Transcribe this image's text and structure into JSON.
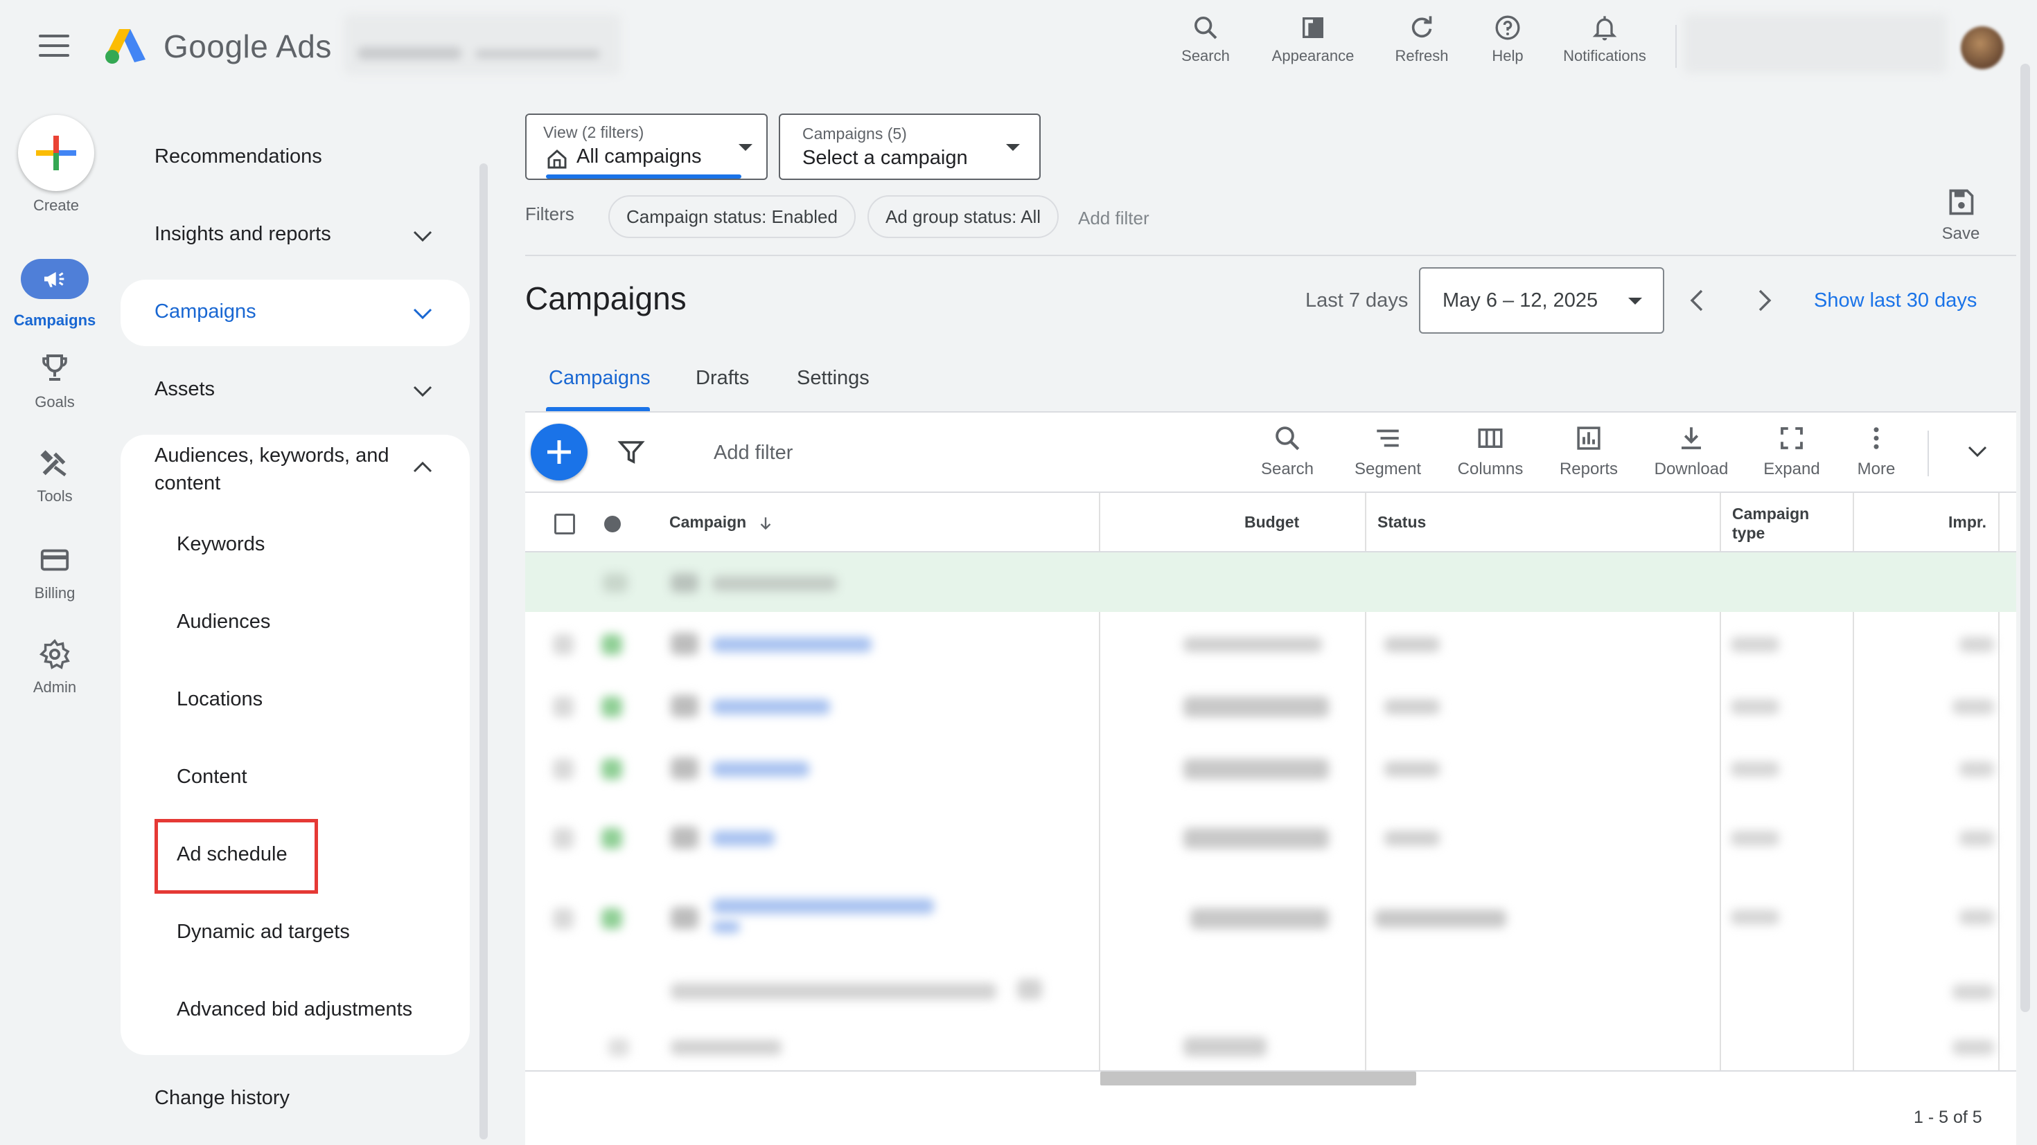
{
  "app": {
    "brand_google": "Google",
    "brand_ads": "Ads"
  },
  "topbar": {
    "items": [
      {
        "label": "Search",
        "icon": "search-icon"
      },
      {
        "label": "Appearance",
        "icon": "appearance-icon"
      },
      {
        "label": "Refresh",
        "icon": "refresh-icon"
      },
      {
        "label": "Help",
        "icon": "help-icon"
      },
      {
        "label": "Notifications",
        "icon": "bell-icon"
      }
    ]
  },
  "rail": {
    "create": "Create",
    "items": [
      {
        "label": "Campaigns",
        "icon": "megaphone-icon",
        "active": true
      },
      {
        "label": "Goals",
        "icon": "trophy-icon"
      },
      {
        "label": "Tools",
        "icon": "tools-icon"
      },
      {
        "label": "Billing",
        "icon": "credit-card-icon"
      },
      {
        "label": "Admin",
        "icon": "gear-icon"
      }
    ]
  },
  "nav": {
    "recommendations": "Recommendations",
    "insights": "Insights and reports",
    "campaigns": "Campaigns",
    "assets": "Assets",
    "audiences_line1": "Audiences, keywords, and",
    "audiences_line2": "content",
    "sub_items": [
      "Keywords",
      "Audiences",
      "Locations",
      "Content",
      "Ad schedule",
      "Dynamic ad targets",
      "Advanced bid adjustments"
    ],
    "highlighted": "Ad schedule",
    "change_history": "Change history"
  },
  "filters_bar": {
    "view_small": "View (2 filters)",
    "view_main": "All campaigns",
    "campaigns_small": "Campaigns (5)",
    "campaigns_main": "Select a campaign",
    "filters_label": "Filters",
    "chips": [
      "Campaign status: Enabled",
      "Ad group status: All"
    ],
    "add_filter": "Add filter",
    "save": "Save"
  },
  "page": {
    "title": "Campaigns",
    "date_label": "Last 7 days",
    "date_range": "May 6 – 12, 2025",
    "show_last": "Show last 30 days"
  },
  "tabs": [
    "Campaigns",
    "Drafts",
    "Settings"
  ],
  "toolbar": {
    "add_filter": "Add filter",
    "tools": [
      {
        "label": "Search",
        "icon": "search-icon"
      },
      {
        "label": "Segment",
        "icon": "segment-icon"
      },
      {
        "label": "Columns",
        "icon": "columns-icon"
      },
      {
        "label": "Reports",
        "icon": "reports-icon"
      },
      {
        "label": "Download",
        "icon": "download-icon"
      },
      {
        "label": "Expand",
        "icon": "expand-icon"
      },
      {
        "label": "More",
        "icon": "more-vert-icon"
      }
    ]
  },
  "table": {
    "headers": {
      "campaign": "Campaign",
      "budget": "Budget",
      "status": "Status",
      "type_line1": "Campaign",
      "type_line2": "type",
      "impr": "Impr."
    },
    "row_count": 5,
    "pagination": "1 - 5 of 5"
  },
  "colors": {
    "accent": "#1a73e8",
    "active_text": "#1967d2",
    "highlight_border": "#e53935",
    "enabled_green": "#4caf50"
  }
}
